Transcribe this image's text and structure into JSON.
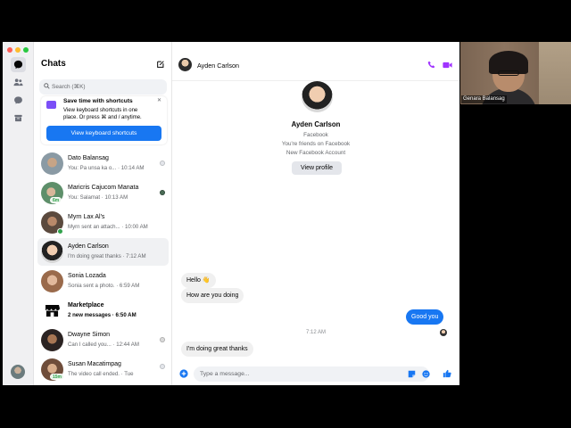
{
  "sidebar": {
    "title": "Chats",
    "search_placeholder": "Search (⌘K)"
  },
  "promo": {
    "title": "Save time with shortcuts",
    "description": "View keyboard shortcuts in one place. Or press ⌘ and / anytime.",
    "button_label": "View keyboard shortcuts"
  },
  "conversations": [
    {
      "name": "Dato Balansag",
      "preview": "You: Pa unsa ka o... · 10:14 AM",
      "bold": false
    },
    {
      "name": "Maricris Cajucom Manata",
      "preview": "You: Salamat · 10:13 AM",
      "badge": "6m",
      "bold": false
    },
    {
      "name": "Myrn Lax Al's",
      "preview": "Myrn sent an attach... · 10:00 AM",
      "bold": false
    },
    {
      "name": "Ayden Carlson",
      "preview": "I'm doing great thanks · 7:12 AM",
      "bold": false,
      "selected": true
    },
    {
      "name": "Sonia Lozada",
      "preview": "Sonia sent a photo. · 6:59 AM",
      "bold": false
    },
    {
      "name": "Marketplace",
      "preview": "2 new messages · 6:50 AM",
      "bold": true
    },
    {
      "name": "Dwayne Simon",
      "preview": "Can I called you... · 12:44 AM",
      "bold": false
    },
    {
      "name": "Susan Macatimpag",
      "preview": "The video call ended. · Tue",
      "badge": "15m",
      "bold": false
    }
  ],
  "conversation": {
    "contact_name": "Ayden Carlson",
    "profile": {
      "name": "Ayden Carlson",
      "line1": "Facebook",
      "line2": "You're friends on Facebook",
      "line3": "New Facebook Account",
      "button_label": "View profile"
    },
    "messages": [
      {
        "text": "Hello 👋",
        "direction": "in"
      },
      {
        "text": "How are you doing",
        "direction": "in"
      },
      {
        "text": "Good you",
        "direction": "out"
      },
      {
        "text": "I'm doing great thanks",
        "direction": "in"
      }
    ],
    "time_separator": "7:12 AM",
    "input_placeholder": "Type a message..."
  },
  "video_call": {
    "participant_name": "Genara Balansag"
  },
  "colors": {
    "accent": "#1877f2",
    "call_icon": "#a033ff",
    "online": "#31a24c"
  }
}
